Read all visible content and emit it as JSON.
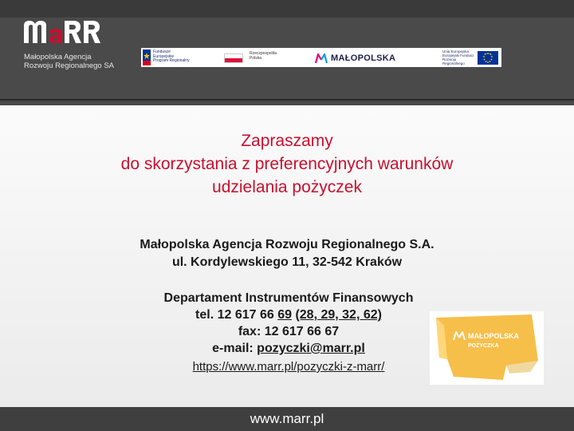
{
  "header": {
    "logo_text": "maRR",
    "logo_subtitle_line1": "Małopolska Agencja",
    "logo_subtitle_line2": "Rozwoju Regionalnego SA",
    "eu_strip": {
      "fe_line1": "Fundusze",
      "fe_line2": "Europejskie",
      "fe_line3": "Program Regionalny",
      "pl_line1": "Rzeczpospolita",
      "pl_line2": "Polska",
      "mp_text": "MAŁOPOLSKA",
      "ue_line1": "Unia Europejska",
      "ue_line2": "Europejski Fundusz",
      "ue_line3": "Rozwoju Regionalnego"
    }
  },
  "main": {
    "title_line1": "Zapraszamy",
    "title_line2": "do skorzystania z preferencyjnych warunków",
    "title_line3": "udzielania pożyczek",
    "org_line1": "Małopolska Agencja Rozwoju Regionalnego S.A.",
    "org_line2": "ul. Kordylewskiego 11, 32-542 Kraków",
    "dept_name": "Departament Instrumentów Finansowych",
    "phone_prefix": "tel. 12 617 66 ",
    "phone_ext": "69",
    "phone_space": " ",
    "phone_alt": "(28, 29, 32, 62)",
    "fax": "fax: 12 617 66 67",
    "email_label": "e-mail: ",
    "email": "pozyczki@marr.pl",
    "url": "https://www.marr.pl/pozyczki-z-marr/",
    "badge_line1": "MAŁOPOLSKA",
    "badge_line2": "POŻYCZKA"
  },
  "footer": {
    "url": "www.marr.pl"
  },
  "colors": {
    "accent_red": "#c8102e",
    "header_gray": "#4a4a4a",
    "footer_gray": "#3f3f3f",
    "badge_yellow": "#f6bf4a"
  }
}
